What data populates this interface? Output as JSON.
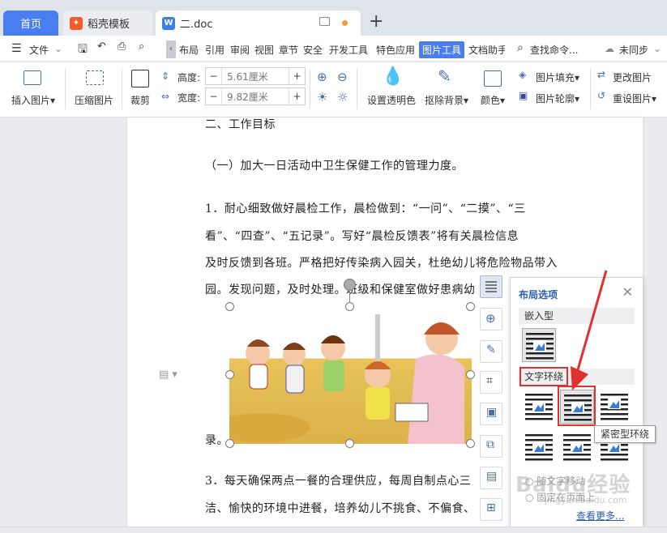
{
  "tabs": {
    "home": "首页",
    "template": "稻壳模板",
    "doc": "二.doc"
  },
  "menu": {
    "file": "文件",
    "items": [
      "布局",
      "引用",
      "审阅",
      "视图",
      "章节",
      "安全",
      "开发工具",
      "特色应用",
      "图片工具",
      "文档助手"
    ],
    "active": "图片工具",
    "search": "查找命令...",
    "sync": "未同步"
  },
  "ribbon": {
    "insert_picture": "插入图片",
    "compress_picture": "压缩图片",
    "crop": "裁剪",
    "height_label": "高度:",
    "height_value": "5.61厘米",
    "width_label": "宽度:",
    "width_value": "9.82厘米",
    "transparency": "设置透明色",
    "remove_bg": "抠除背景",
    "color": "颜色",
    "fill": "图片填充",
    "outline": "图片轮廓",
    "change": "更改图片",
    "reset": "重设图片"
  },
  "document": {
    "lines": [
      "二、工作目标",
      "（一）加大一日活动中卫生保健工作的管理力度。",
      "1．耐心细致做好晨检工作，晨检做到：“一问”、“二摸”、“三",
      "看”、“四查”、“五记录”。写好“晨检反馈表”将有关晨检信息",
      "及时反馈到各班。严格把好传染病入园关，杜绝幼儿将危险物品带入",
      "园。发现问题，及时处理。班级和保健室做好患病幼",
      "录。",
      "3．每天确保两点一餐的合理供应，每周自制点心三",
      "洁、愉快的环境中进餐，培养幼儿不挑食、不偏食、"
    ]
  },
  "layout_panel": {
    "title": "布局选项",
    "inline_section": "嵌入型",
    "wrap_section": "文字环绕",
    "tooltip": "紧密型环绕",
    "move_with_text": "随文字移动",
    "fix_position": "固定在页面上",
    "more": "查看更多..."
  },
  "watermark": {
    "main": "Baidu经验",
    "sub": "jingyan.baidu.com"
  },
  "colors": {
    "accent": "#4a7df0",
    "highlight_red": "#e0312e"
  }
}
